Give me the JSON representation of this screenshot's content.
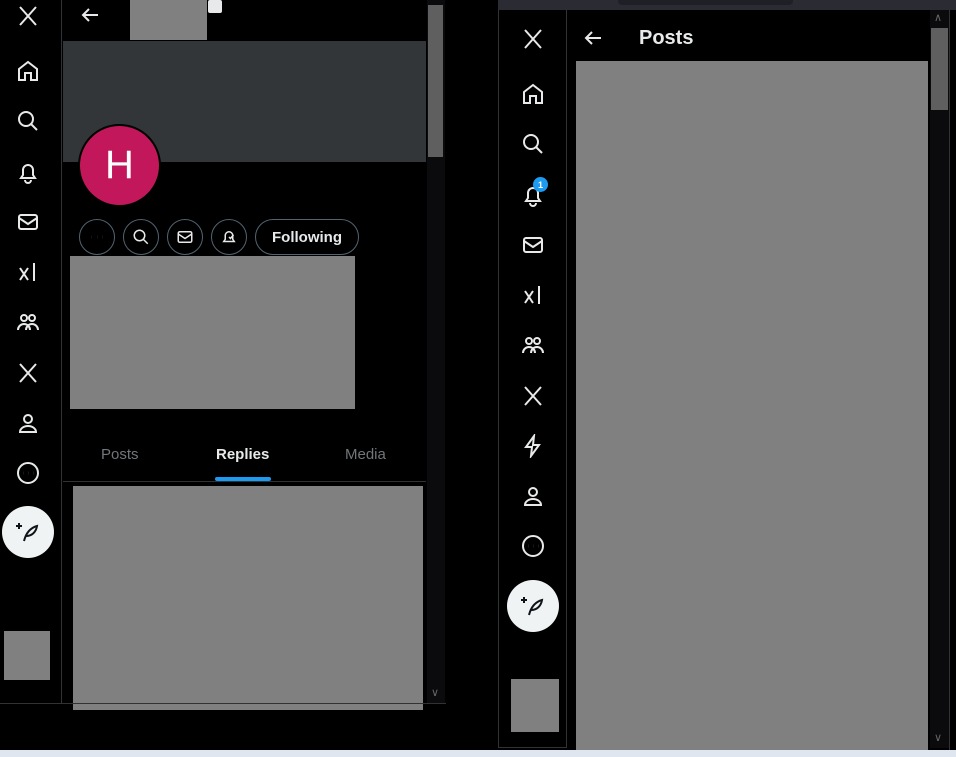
{
  "left_window": {
    "avatar_initial": "H",
    "following_label": "Following",
    "tabs": [
      "Posts",
      "Replies",
      "Media"
    ],
    "active_tab": "Replies"
  },
  "right_window": {
    "header_title": "Posts",
    "notification_count": "1"
  },
  "colors": {
    "avatar": "#c2185b",
    "accent": "#1d9bf0",
    "banner": "#333639"
  }
}
